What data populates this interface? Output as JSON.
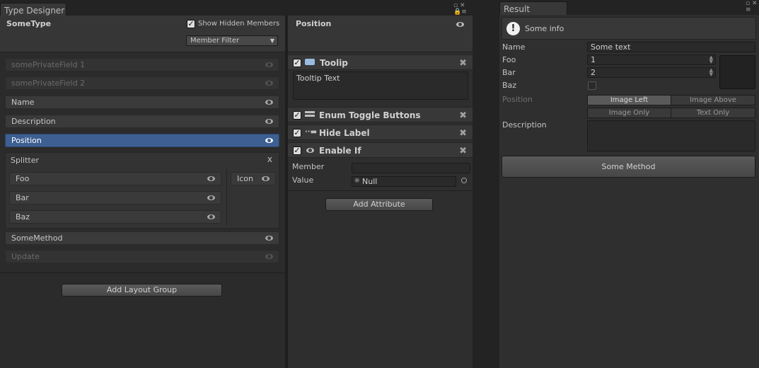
{
  "designer": {
    "tab_title": "Type Designer",
    "type_name": "SomeType",
    "show_hidden_label": "Show Hidden Members",
    "show_hidden_checked": true,
    "member_filter": "Member Filter",
    "members": [
      {
        "label": "somePrivateField 1",
        "state": "hidden"
      },
      {
        "label": "somePrivateField 2",
        "state": "hidden"
      },
      {
        "label": "Name",
        "state": "normal"
      },
      {
        "label": "Description",
        "state": "normal"
      },
      {
        "label": "Position",
        "state": "selected"
      }
    ],
    "splitter_label": "Splitter",
    "splitter_close": "x",
    "splitter_left": [
      "Foo",
      "Bar",
      "Baz"
    ],
    "splitter_right": "Icon",
    "after_members": [
      {
        "label": "SomeMethod",
        "state": "normal"
      },
      {
        "label": "Update",
        "state": "hidden"
      }
    ],
    "add_layout_group": "Add Layout Group"
  },
  "inspector": {
    "title": "Position",
    "attributes": {
      "tooltip": {
        "label": "Toolip",
        "text": "Tooltip Text"
      },
      "enum_toggle": {
        "label": "Enum Toggle Buttons"
      },
      "hide_label": {
        "label": "Hide Label"
      },
      "enable_if": {
        "label": "Enable If",
        "member_label": "Member",
        "member_value": "",
        "value_label": "Value",
        "value": "Null"
      }
    },
    "add_attribute": "Add Attribute"
  },
  "result": {
    "tab_title": "Result",
    "info_text": "Some info",
    "name_label": "Name",
    "name_value": "Some text",
    "foo_label": "Foo",
    "foo_value": "1",
    "bar_label": "Bar",
    "bar_value": "2",
    "baz_label": "Baz",
    "baz_checked": false,
    "position_label": "Position",
    "position_options": [
      "Image Left",
      "Image Above",
      "Image Only",
      "Text Only"
    ],
    "position_selected": "Image Left",
    "description_label": "Description",
    "description_value": "",
    "method_button": "Some Method"
  },
  "colors": {
    "selection": "#3d5f91",
    "panel": "#2e2e2e",
    "background": "#232323"
  },
  "icons": [
    "eye-icon",
    "lock-icon",
    "menu-icon",
    "close-icon",
    "tooltip-icon",
    "enum-toggle-icon",
    "hide-label-icon",
    "info-icon",
    "object-picker-icon"
  ]
}
